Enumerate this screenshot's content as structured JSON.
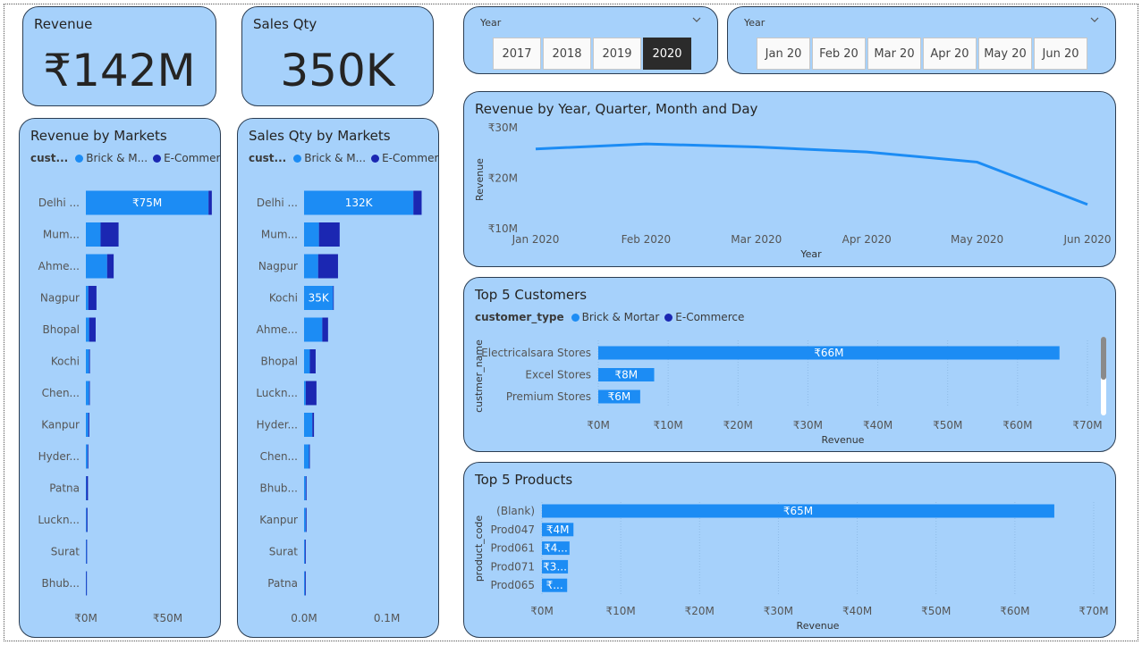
{
  "colors": {
    "panel": "#a6d1fb",
    "brick": "#1c8cf4",
    "ecom": "#1b27b2",
    "line": "#1c8cf4",
    "selected_chip": "#2b2b2b"
  },
  "kpi": {
    "revenue": {
      "title": "Revenue",
      "value": "₹142M"
    },
    "sales_qty": {
      "title": "Sales Qty",
      "value": "350K"
    }
  },
  "slicers": {
    "year": {
      "label": "Year",
      "options": [
        "2017",
        "2018",
        "2019",
        "2020"
      ],
      "selected": "2020"
    },
    "month": {
      "label": "Year",
      "options": [
        "Jan 20",
        "Feb 20",
        "Mar 20",
        "Apr 20",
        "May 20",
        "Jun 20"
      ]
    }
  },
  "legend": {
    "short_label": "cust...",
    "full_label": "customer_type",
    "brick_short": "Brick & M...",
    "brick_full": "Brick & Mortar",
    "ecom": "E-Commerce"
  },
  "chart_data": [
    {
      "id": "revenue_by_markets",
      "type": "bar",
      "orientation": "horizontal",
      "stacked": true,
      "title": "Revenue by Markets",
      "categories": [
        "Delhi ...",
        "Mum...",
        "Ahme...",
        "Nagpur",
        "Bhopal",
        "Kochi",
        "Chen...",
        "Kanpur",
        "Hyder...",
        "Patna",
        "Luckn...",
        "Surat",
        "Bhub..."
      ],
      "series": [
        {
          "name": "Brick & M...",
          "values": [
            75,
            9,
            13,
            1.5,
            2,
            2,
            2,
            1.5,
            1,
            0.3,
            0.4,
            0.3,
            0.2
          ]
        },
        {
          "name": "E-Commerce",
          "values": [
            2,
            11,
            4,
            5,
            4,
            0.5,
            0.4,
            0.6,
            0.5,
            1,
            0.6,
            0.3,
            0.2
          ]
        }
      ],
      "data_labels": [
        "₹75M",
        "",
        "",
        "",
        "",
        "",
        "",
        "",
        "",
        "",
        "",
        "",
        ""
      ],
      "x_ticks": [
        "₹0M",
        "₹50M"
      ],
      "x_tick_values": [
        0,
        50
      ],
      "xlim": [
        0,
        82
      ]
    },
    {
      "id": "sales_qty_by_markets",
      "type": "bar",
      "orientation": "horizontal",
      "stacked": true,
      "title": "Sales Qty by Markets",
      "categories": [
        "Delhi ...",
        "Mum...",
        "Nagpur",
        "Kochi",
        "Ahme...",
        "Bhopal",
        "Luckn...",
        "Hyder...",
        "Chen...",
        "Bhub...",
        "Kanpur",
        "Surat",
        "Patna"
      ],
      "series": [
        {
          "name": "Brick & M...",
          "values": [
            132,
            18,
            17,
            35,
            22,
            7,
            2,
            10,
            6,
            2,
            2,
            1,
            1
          ]
        },
        {
          "name": "E-Commerce",
          "values": [
            10,
            25,
            24,
            0,
            7,
            7,
            13,
            2,
            1,
            1,
            1,
            1,
            1
          ]
        }
      ],
      "data_labels": [
        "132K",
        "",
        "",
        "35K",
        "",
        "",
        "",
        "",
        "",
        "",
        "",
        "",
        ""
      ],
      "x_ticks": [
        "0.0M",
        "0.1M"
      ],
      "x_tick_values": [
        0,
        100
      ],
      "xlim": [
        0,
        162
      ]
    },
    {
      "id": "revenue_by_date",
      "type": "line",
      "title": "Revenue by Year, Quarter, Month and Day",
      "x": [
        "Jan 2020",
        "Feb 2020",
        "Mar 2020",
        "Apr 2020",
        "May 2020",
        "Jun 2020"
      ],
      "values": [
        25.8,
        26.8,
        26.2,
        25.2,
        23.2,
        14.8
      ],
      "xlabel": "Year",
      "ylabel": "Revenue",
      "y_ticks": [
        "₹10M",
        "₹20M",
        "₹30M"
      ],
      "y_tick_values": [
        10,
        20,
        30
      ],
      "ylim": [
        10,
        30
      ]
    },
    {
      "id": "top_5_customers",
      "type": "bar",
      "orientation": "horizontal",
      "title": "Top 5 Customers",
      "categories": [
        "Electricalsara Stores",
        "Excel Stores",
        "Premium Stores"
      ],
      "values": [
        66,
        8,
        6
      ],
      "data_labels": [
        "₹66M",
        "₹8M",
        "₹6M"
      ],
      "xlabel": "Revenue",
      "ylabel": "custmer_name",
      "x_ticks": [
        "₹0M",
        "₹10M",
        "₹20M",
        "₹30M",
        "₹40M",
        "₹50M",
        "₹60M",
        "₹70M"
      ],
      "x_tick_values": [
        0,
        10,
        20,
        30,
        40,
        50,
        60,
        70
      ],
      "xlim": [
        0,
        70
      ]
    },
    {
      "id": "top_5_products",
      "type": "bar",
      "orientation": "horizontal",
      "title": "Top 5 Products",
      "categories": [
        "(Blank)",
        "Prod047",
        "Prod061",
        "Prod071",
        "Prod065"
      ],
      "values": [
        65,
        4,
        3.5,
        3.3,
        3.2
      ],
      "data_labels": [
        "₹65M",
        "₹4M",
        "₹4...",
        "₹3...",
        "₹..."
      ],
      "xlabel": "Revenue",
      "ylabel": "product_code",
      "x_ticks": [
        "₹0M",
        "₹10M",
        "₹20M",
        "₹30M",
        "₹40M",
        "₹50M",
        "₹60M",
        "₹70M"
      ],
      "x_tick_values": [
        0,
        10,
        20,
        30,
        40,
        50,
        60,
        70
      ],
      "xlim": [
        0,
        70
      ]
    }
  ]
}
